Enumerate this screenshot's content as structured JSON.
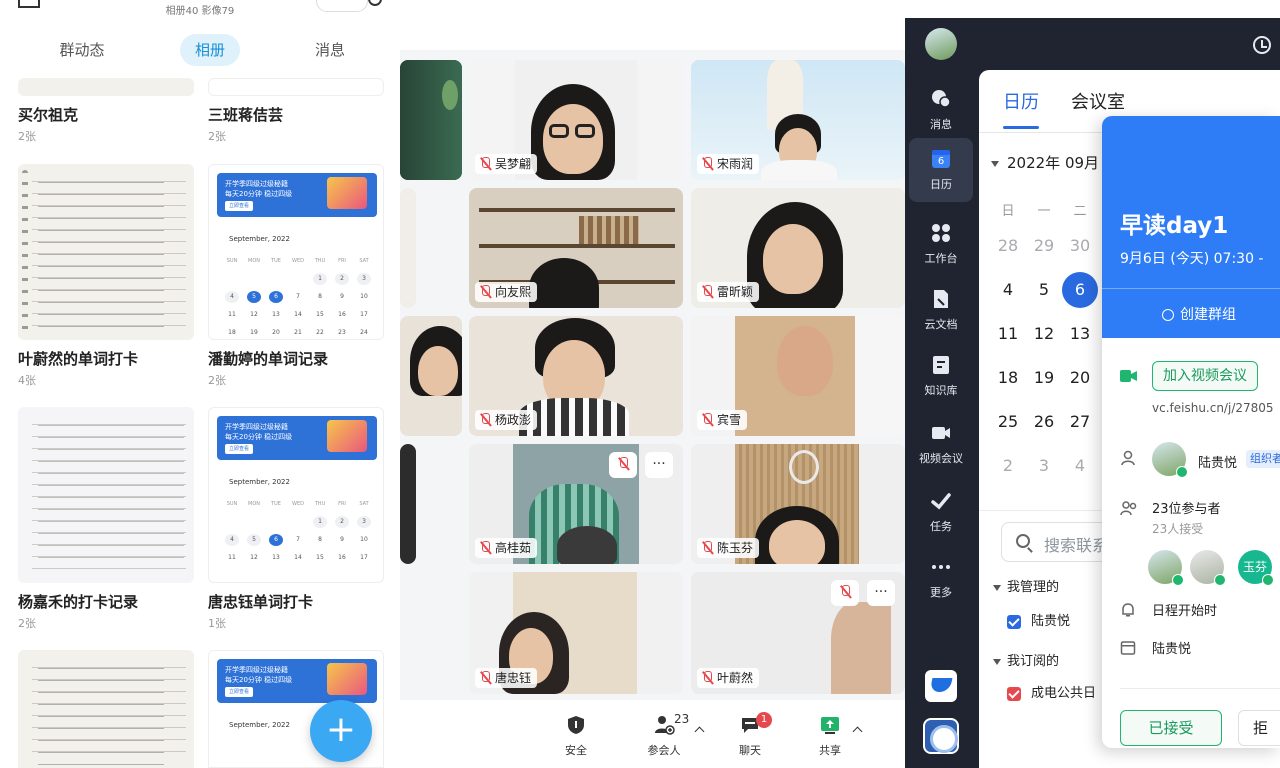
{
  "album": {
    "header_sub": "相册40 影像79",
    "tabs": [
      "群动态",
      "相册",
      "消息"
    ],
    "active_tab": "相册",
    "items": [
      {
        "name": "买尔祖克",
        "count": "2张"
      },
      {
        "name": "三班蒋佶芸",
        "count": "2张"
      },
      {
        "name": "叶蔚然的单词打卡",
        "count": "4张"
      },
      {
        "name": "潘勤婷的单词记录",
        "count": "2张"
      },
      {
        "name": "杨嘉禾的打卡记录",
        "count": "2张"
      },
      {
        "name": "唐忠钰单词打卡",
        "count": "1张"
      }
    ],
    "notice": {
      "line1": "开学季四级过级秘籍",
      "line2": "每天20分钟 稳过四级",
      "button": "立即查看",
      "month": "September, 2022",
      "weekdays": [
        "SUN",
        "MON",
        "TUE",
        "WED",
        "THU",
        "FRI",
        "SAT"
      ],
      "weeks": [
        [
          "",
          "",
          "",
          "",
          "1",
          "2",
          "3"
        ],
        [
          "4",
          "5",
          "6",
          "7",
          "8",
          "9",
          "10"
        ],
        [
          "11",
          "12",
          "13",
          "14",
          "15",
          "16",
          "17"
        ],
        [
          "18",
          "19",
          "20",
          "21",
          "22",
          "23",
          "24"
        ]
      ]
    },
    "fab_label": "+"
  },
  "meeting": {
    "participants": [
      "吴梦翩",
      "宋雨润",
      "向友熙",
      "雷昕颖",
      "杨政澎",
      "宾雪",
      "高桂茹",
      "陈玉芬",
      "唐忠钰",
      "叶蔚然"
    ],
    "more_label": "···",
    "toolbar": [
      {
        "label": "安全"
      },
      {
        "label": "参会人",
        "count": "23"
      },
      {
        "label": "聊天",
        "badge": "1"
      },
      {
        "label": "共享"
      }
    ]
  },
  "feishu": {
    "rail": [
      "消息",
      "日历",
      "工作台",
      "云文档",
      "知识库",
      "视频会议",
      "任务",
      "更多"
    ],
    "rail_active": "日历",
    "calendar_day_icon": "6",
    "tabs": [
      "日历",
      "会议室"
    ],
    "month": "2022年 09月",
    "weekdays": [
      "日",
      "一",
      "二"
    ],
    "days": [
      [
        "28",
        "29",
        "30"
      ],
      [
        "4",
        "5",
        "6"
      ],
      [
        "11",
        "12",
        "13"
      ],
      [
        "18",
        "19",
        "20"
      ],
      [
        "25",
        "26",
        "27"
      ],
      [
        "2",
        "3",
        "4"
      ]
    ],
    "search_placeholder": "搜索联系",
    "group_managed": "我管理的",
    "managed_calendar": "陆贵悦",
    "group_subscribed": "我订阅的",
    "subscribed_calendar": "成电公共日",
    "event": {
      "title": "早读day1",
      "time": "9月6日 (今天) 07:30 -",
      "create_group": "创建群组",
      "join_video": "加入视频会议",
      "link": "vc.feishu.cn/j/27805",
      "organizer": "陆贵悦",
      "organizer_tag": "组织者",
      "attendees": "23位参与者",
      "accepted": "23人接受",
      "avatar_label": "玉芬",
      "reminder": "日程开始时",
      "calendar": "陆贵悦",
      "accept_button": "已接受",
      "reject_button": "拒"
    }
  }
}
